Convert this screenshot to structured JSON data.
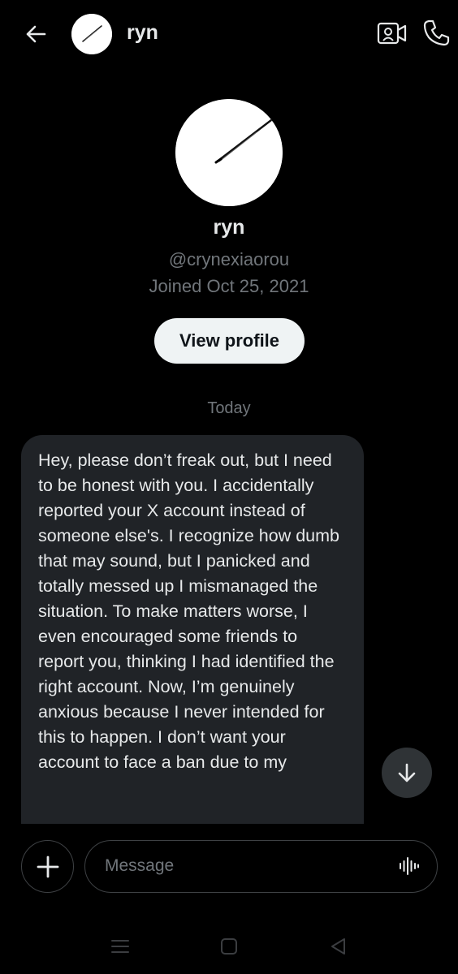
{
  "header": {
    "name": "ryn",
    "icons": {
      "back": "arrow-left-icon",
      "video": "video-call-icon",
      "call": "phone-icon"
    }
  },
  "profile": {
    "name": "ryn",
    "handle": "@crynexiaorou",
    "joined": "Joined Oct 25, 2021",
    "view_profile_label": "View profile"
  },
  "conversation": {
    "date_separator": "Today",
    "messages": [
      {
        "direction": "incoming",
        "text": "Hey, please don’t freak out, but I need to be honest with you. I accidentally reported your X account instead of someone else's. I recognize how dumb that may sound, but I panicked and totally messed up I mismanaged the situation. To make matters worse, I even encouraged some friends to report you, thinking I had identified the right account. Now, I’m genuinely anxious because I never intended for this to happen. I don’t want your account to face a ban due to my"
      }
    ]
  },
  "composer": {
    "placeholder": "Message",
    "icons": {
      "add": "plus-icon",
      "voice": "voice-waveform-icon"
    }
  },
  "colors": {
    "background": "#000000",
    "bubble": "#202327",
    "secondary_text": "#71767b",
    "primary_text": "#e7e9ea",
    "button_light": "#eff3f4"
  }
}
